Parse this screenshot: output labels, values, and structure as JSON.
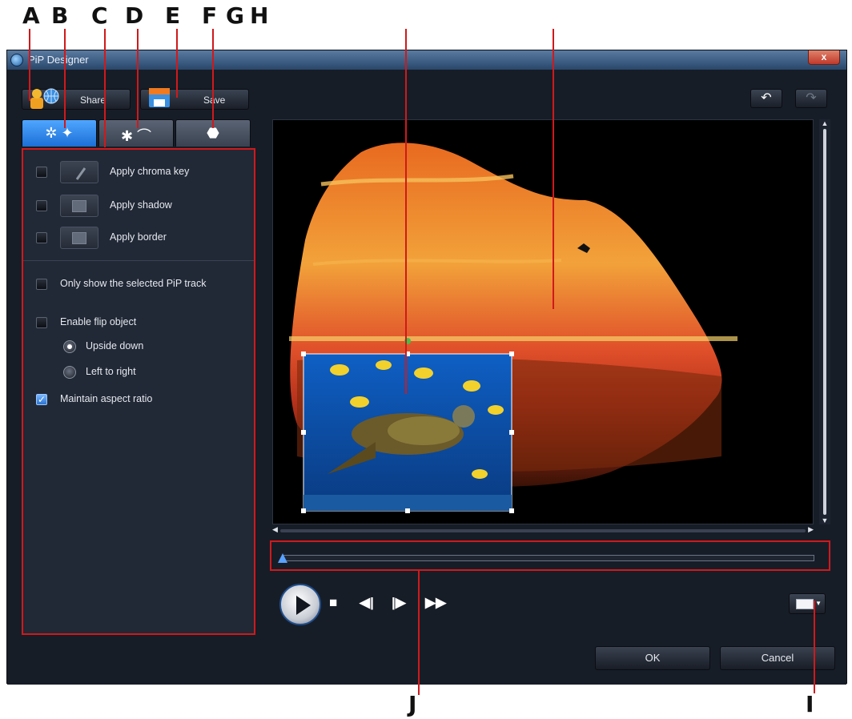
{
  "window": {
    "title": "PiP Designer",
    "close_label": "x"
  },
  "toolbar": {
    "share_label": "Share",
    "save_label": "Save"
  },
  "callouts": {
    "A": "A",
    "B": "B",
    "C": "C",
    "D": "D",
    "E": "E",
    "F": "F",
    "G": "G",
    "H": "H",
    "I": "I",
    "J": "J"
  },
  "tabs": [
    {
      "name": "properties",
      "icon": "properties-gear-icon",
      "active": true
    },
    {
      "name": "motion",
      "icon": "motion-path-icon",
      "active": false
    },
    {
      "name": "mask",
      "icon": "mask-shape-icon",
      "active": false
    }
  ],
  "properties": {
    "chroma_key": {
      "label": "Apply chroma key",
      "checked": false
    },
    "shadow": {
      "label": "Apply shadow",
      "checked": false
    },
    "border": {
      "label": "Apply border",
      "checked": false
    },
    "only_selected": {
      "label": "Only show the selected PiP track",
      "checked": false
    },
    "flip": {
      "label": "Enable flip object",
      "checked": false
    },
    "upside_down": {
      "label": "Upside down",
      "selected": true
    },
    "left_to_right": {
      "label": "Left to right",
      "selected": false
    },
    "aspect": {
      "label": "Maintain aspect ratio",
      "checked": true
    }
  },
  "playback": {
    "position": 0.0
  },
  "dialog": {
    "ok_label": "OK",
    "cancel_label": "Cancel"
  },
  "colors": {
    "accent": "#2a74d3",
    "callout_red": "#d0191c",
    "window_bg": "#171d27"
  }
}
